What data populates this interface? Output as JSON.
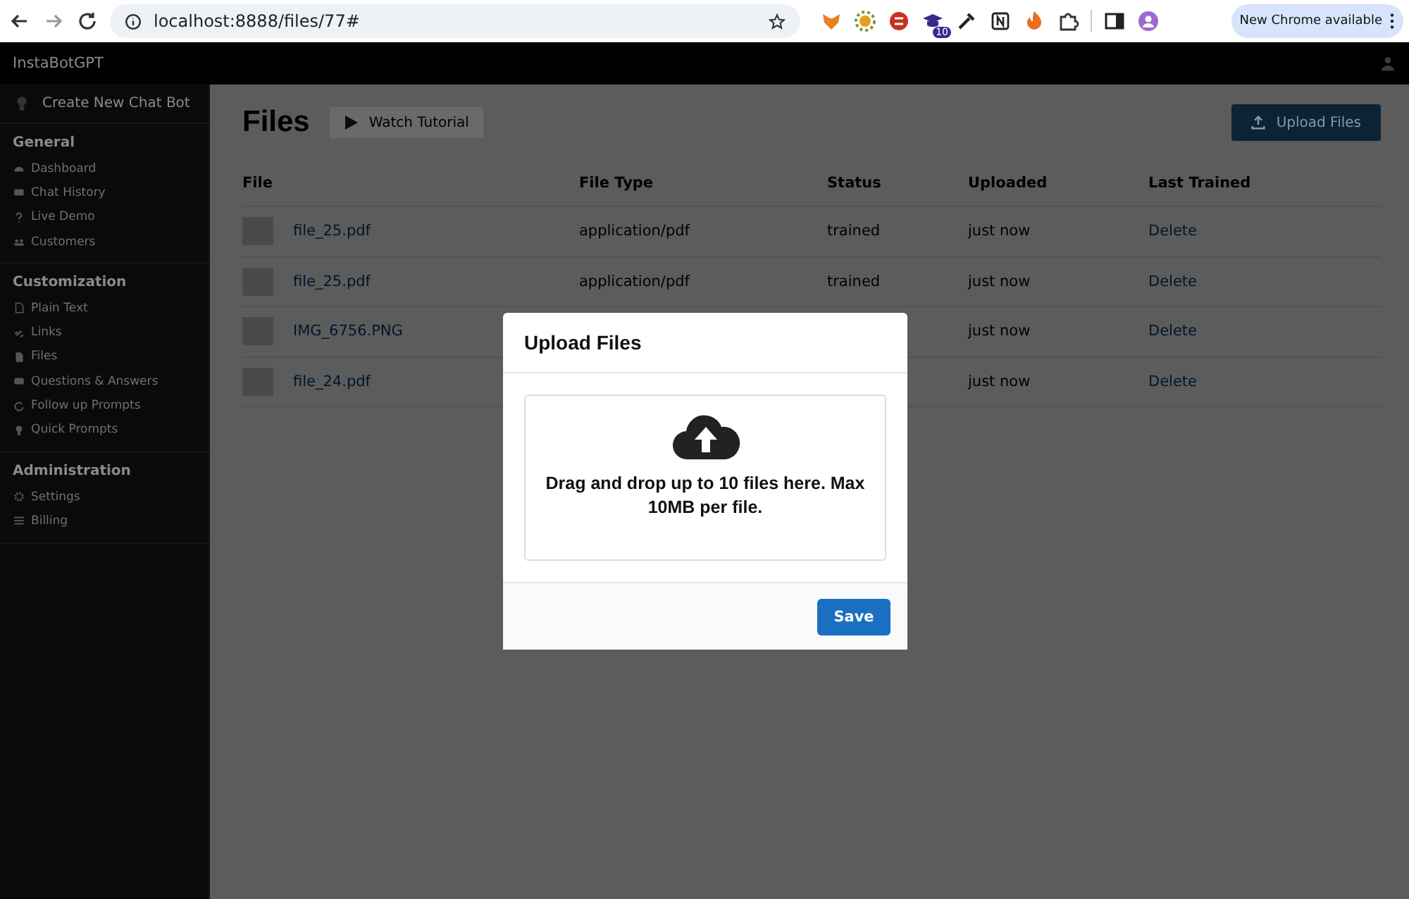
{
  "browser": {
    "url": "localhost:8888/files/77#",
    "extension_badge": "10",
    "update_button": "New Chrome available"
  },
  "app": {
    "brand": "InstaBotGPT",
    "create_button": "Create New Chat Bot"
  },
  "sidebar": {
    "sections": [
      {
        "title": "General",
        "items": [
          {
            "label": "Dashboard"
          },
          {
            "label": "Chat History"
          },
          {
            "label": "Live Demo"
          },
          {
            "label": "Customers"
          }
        ]
      },
      {
        "title": "Customization",
        "items": [
          {
            "label": "Plain Text"
          },
          {
            "label": "Links"
          },
          {
            "label": "Files"
          },
          {
            "label": "Questions & Answers"
          },
          {
            "label": "Follow up Prompts"
          },
          {
            "label": "Quick Prompts"
          }
        ]
      },
      {
        "title": "Administration",
        "items": [
          {
            "label": "Settings"
          },
          {
            "label": "Billing"
          }
        ]
      }
    ]
  },
  "page": {
    "title": "Files",
    "tutorial_button": "Watch Tutorial",
    "upload_button": "Upload Files"
  },
  "table": {
    "columns": [
      "File",
      "File Type",
      "Status",
      "Uploaded",
      "Last Trained"
    ],
    "rows": [
      {
        "file": "file_25.pdf",
        "file_type": "application/pdf",
        "status": "trained",
        "uploaded": "just now",
        "action": "Delete"
      },
      {
        "file": "file_25.pdf",
        "file_type": "application/pdf",
        "status": "trained",
        "uploaded": "just now",
        "action": "Delete"
      },
      {
        "file": "IMG_6756.PNG",
        "uploaded": "just now",
        "action": "Delete"
      },
      {
        "file": "file_24.pdf",
        "uploaded": "just now",
        "action": "Delete"
      }
    ]
  },
  "modal": {
    "title": "Upload Files",
    "dropzone_text": "Drag and drop up to 10 files here. Max 10MB per file.",
    "save_button": "Save"
  }
}
